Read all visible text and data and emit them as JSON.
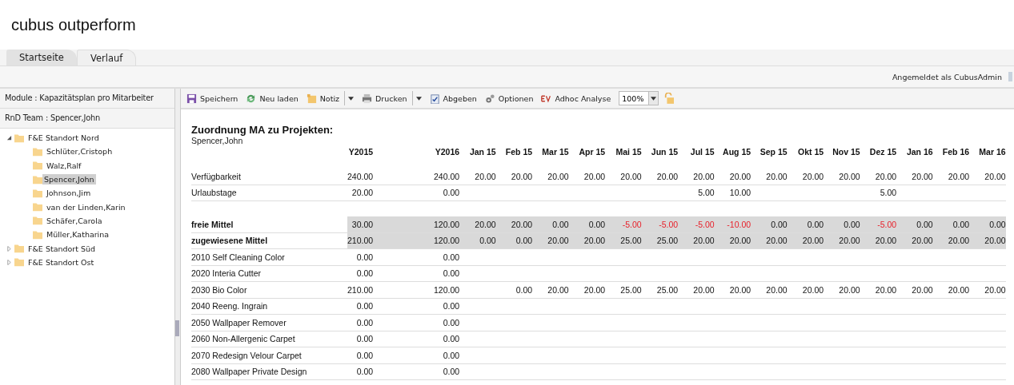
{
  "app_title": "cubus outperform",
  "tabs": [
    {
      "label": "Startseite",
      "selected": true
    },
    {
      "label": "Verlauf",
      "selected": false
    }
  ],
  "login_status": "Angemeldet als CubusAdmin",
  "sidebar": {
    "module": "Module : Kapazitätsplan pro Mitarbeiter",
    "team": "RnD Team : Spencer,John",
    "tree": [
      {
        "label": "F&E Standort Nord",
        "expanded": true,
        "selected": false,
        "children": [
          {
            "label": "Schlüter,Cristoph",
            "selected": false
          },
          {
            "label": "Walz,Ralf",
            "selected": false
          },
          {
            "label": "Spencer,John",
            "selected": true
          },
          {
            "label": "Johnson,Jim",
            "selected": false
          },
          {
            "label": "van der Linden,Karin",
            "selected": false
          },
          {
            "label": "Schäfer,Carola",
            "selected": false
          },
          {
            "label": "Müller,Katharina",
            "selected": false
          }
        ]
      },
      {
        "label": "F&E Standort Süd",
        "expanded": false,
        "selected": false
      },
      {
        "label": "F&E Standort Ost",
        "expanded": false,
        "selected": false
      }
    ]
  },
  "toolbar": [
    {
      "kind": "button",
      "label": "Speichern"
    },
    {
      "kind": "button",
      "label": "Neu laden"
    },
    {
      "kind": "split",
      "label": "Notiz"
    },
    {
      "kind": "split",
      "label": "Drucken"
    },
    {
      "kind": "button",
      "label": "Abgeben"
    },
    {
      "kind": "button",
      "label": "Optionen"
    },
    {
      "kind": "button",
      "label": "Adhoc Analyse"
    },
    {
      "kind": "zoom",
      "label": "100%"
    },
    {
      "kind": "lock"
    }
  ],
  "report": {
    "title": "Zuordnung MA zu Projekten:",
    "subtitle": "Spencer,John",
    "columns": [
      "Y2015",
      "Y2016",
      "Jan 15",
      "Feb 15",
      "Mar 15",
      "Apr 15",
      "Mai 15",
      "Jun 15",
      "Jul 15",
      "Aug 15",
      "Sep 15",
      "Okt 15",
      "Nov 15",
      "Dez 15",
      "Jan 16",
      "Feb 16",
      "Mar 16"
    ],
    "rows": [
      {
        "kind": "normal",
        "label": "Verfügbarkeit",
        "cells": [
          "240.00",
          "240.00",
          "20.00",
          "20.00",
          "20.00",
          "20.00",
          "20.00",
          "20.00",
          "20.00",
          "20.00",
          "20.00",
          "20.00",
          "20.00",
          "20.00",
          "20.00",
          "20.00",
          "20.00"
        ]
      },
      {
        "kind": "normal",
        "label": "Urlaubstage",
        "cells": [
          "20.00",
          "0.00",
          null,
          null,
          null,
          null,
          null,
          null,
          "5.00",
          "10.00",
          null,
          null,
          null,
          "5.00",
          null,
          null,
          null
        ]
      },
      {
        "kind": "spacer"
      },
      {
        "kind": "summary",
        "label": "freie Mittel",
        "cells": [
          {
            "value": "30.00",
            "negative": false
          },
          {
            "value": "120.00",
            "negative": false
          },
          {
            "value": "20.00",
            "negative": false
          },
          {
            "value": "20.00",
            "negative": false
          },
          {
            "value": "0.00",
            "negative": false
          },
          {
            "value": "0.00",
            "negative": false
          },
          {
            "value": "-5.00",
            "negative": true
          },
          {
            "value": "-5.00",
            "negative": true
          },
          {
            "value": "-5.00",
            "negative": true
          },
          {
            "value": "-10.00",
            "negative": true
          },
          {
            "value": "0.00",
            "negative": false
          },
          {
            "value": "0.00",
            "negative": false
          },
          {
            "value": "0.00",
            "negative": false
          },
          {
            "value": "-5.00",
            "negative": true
          },
          {
            "value": "0.00",
            "negative": false
          },
          {
            "value": "0.00",
            "negative": false
          },
          {
            "value": "0.00",
            "negative": false
          }
        ]
      },
      {
        "kind": "summary",
        "label": "zugewiesene Mittel",
        "cells": [
          "210.00",
          "120.00",
          "0.00",
          "0.00",
          "20.00",
          "20.00",
          "25.00",
          "25.00",
          "20.00",
          "20.00",
          "20.00",
          "20.00",
          "20.00",
          "20.00",
          "20.00",
          "20.00",
          "20.00"
        ]
      },
      {
        "kind": "normal",
        "label": "2010 Self Cleaning Color",
        "cells": [
          "0.00",
          "0.00"
        ]
      },
      {
        "kind": "normal",
        "label": "2020 Interia Cutter",
        "cells": [
          "0.00",
          "0.00"
        ]
      },
      {
        "kind": "normal",
        "label": "2030 Bio Color",
        "cells": [
          "210.00",
          "120.00",
          null,
          "0.00",
          "20.00",
          "20.00",
          "25.00",
          "25.00",
          "20.00",
          "20.00",
          "20.00",
          "20.00",
          "20.00",
          "20.00",
          "20.00",
          "20.00",
          "20.00"
        ]
      },
      {
        "kind": "normal",
        "label": "2040 Reeng. Ingrain",
        "cells": [
          "0.00",
          "0.00"
        ]
      },
      {
        "kind": "normal",
        "label": "2050 Wallpaper Remover",
        "cells": [
          "0.00",
          "0.00"
        ]
      },
      {
        "kind": "normal",
        "label": "2060 Non-Allergenic Carpet",
        "cells": [
          "0.00",
          "0.00"
        ]
      },
      {
        "kind": "normal",
        "label": "2070 Redesign Velour Carpet",
        "cells": [
          "0.00",
          "0.00"
        ]
      },
      {
        "kind": "normal",
        "label": "2080 Wallpaper Private Design",
        "cells": [
          "0.00",
          "0.00"
        ]
      }
    ]
  }
}
